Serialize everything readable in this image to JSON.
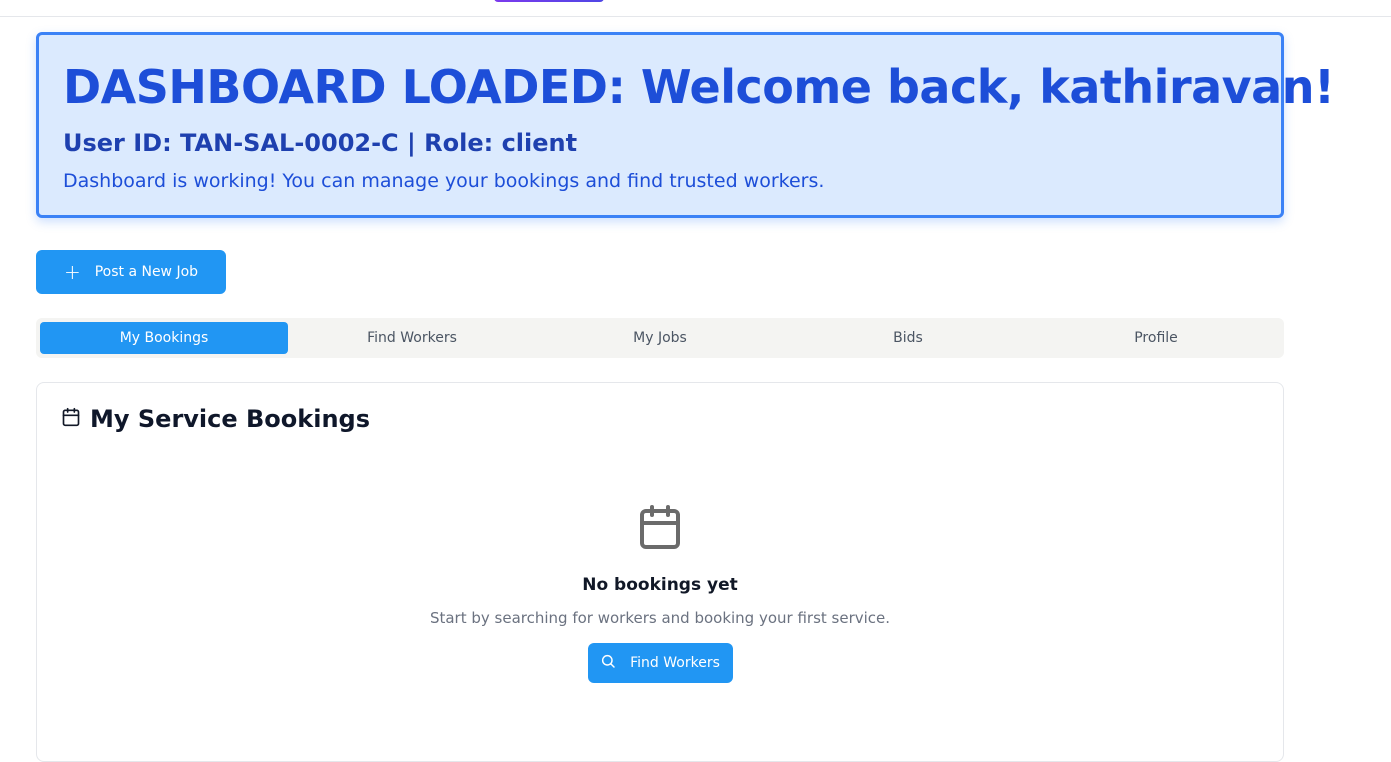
{
  "welcome": {
    "title": "DASHBOARD LOADED: Welcome back, kathiravan!",
    "user_line": "User ID: TAN-SAL-0002-C | Role: client",
    "message": "Dashboard is working! You can manage your bookings and find trusted workers."
  },
  "actions": {
    "post_job_label": "Post a New Job",
    "post_job_icon": "plus-icon"
  },
  "tabs": [
    {
      "label": "My Bookings",
      "active": true
    },
    {
      "label": "Find Workers",
      "active": false
    },
    {
      "label": "My Jobs",
      "active": false
    },
    {
      "label": "Bids",
      "active": false
    },
    {
      "label": "Profile",
      "active": false
    }
  ],
  "bookings": {
    "title": "My Service Bookings",
    "title_icon": "calendar-icon",
    "empty_icon": "calendar-icon",
    "empty_title": "No bookings yet",
    "empty_text": "Start by searching for workers and booking your first service.",
    "find_workers_label": "Find Workers",
    "find_workers_icon": "search-icon"
  },
  "colors": {
    "accent": "#2196f3",
    "welcome_bg": "#dbeafe",
    "welcome_border": "#3b82f6",
    "welcome_text": "#1d4ed8"
  }
}
